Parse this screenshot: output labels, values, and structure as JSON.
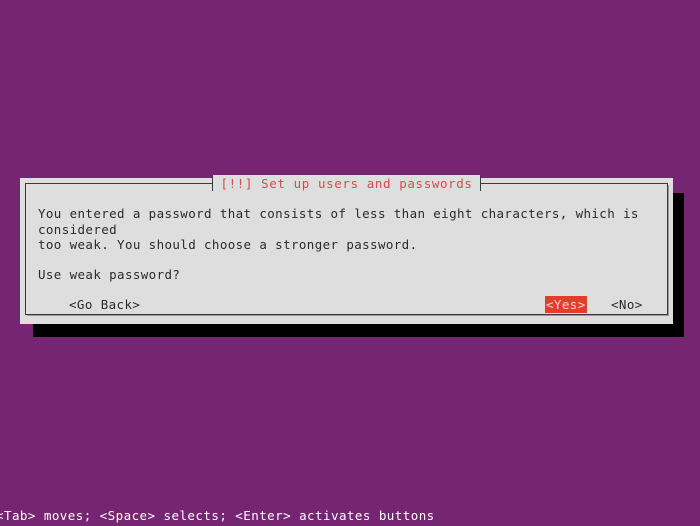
{
  "screen": {
    "background_color": "#762572"
  },
  "dialog": {
    "title": "[!!] Set up users and passwords",
    "title_color": "#d94a4a",
    "background_color": "#dedede",
    "border_color": "#3a3a3a",
    "message": "You entered a password that consists of less than eight characters, which is considered\ntoo weak. You should choose a stronger password.",
    "question": "Use weak password?",
    "buttons": [
      {
        "label": "<Go Back>",
        "selected": false
      },
      {
        "label": "<Yes>",
        "selected": true
      },
      {
        "label": "<No>",
        "selected": false
      }
    ],
    "selection_color": "#e33e2b",
    "selection_text_color": "#f0d8d8"
  },
  "helpbar": {
    "text": "<Tab> moves; <Space> selects; <Enter> activates buttons",
    "text_color": "#ffffff"
  }
}
